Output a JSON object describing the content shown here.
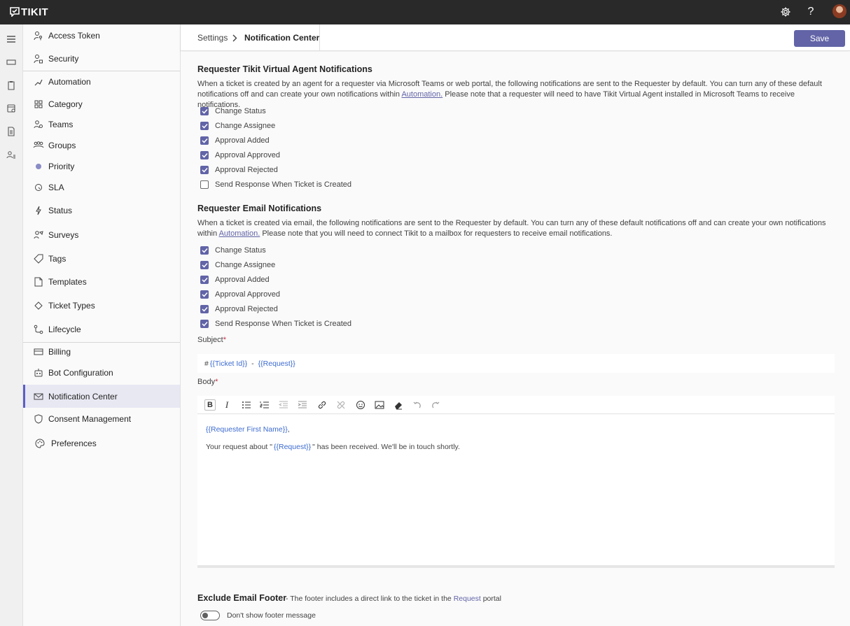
{
  "app": {
    "name": "TIKIT"
  },
  "colors": {
    "accent": "#6264a7",
    "topbar": "#292929",
    "token": "#3c6bd0",
    "required": "#c4314b"
  },
  "topbar_icons": [
    "gear-icon",
    "help-icon",
    "avatar"
  ],
  "topbar_text": {
    "help": "?"
  },
  "rail_icons": [
    "hamburger-icon",
    "tickets-icon",
    "clipboard-icon",
    "calendar-icon",
    "document-icon",
    "people-icon"
  ],
  "sidebar": {
    "items": [
      {
        "label": "Access Token",
        "icon": "key-person-icon"
      },
      {
        "label": "Security",
        "icon": "person-lock-icon"
      },
      {
        "label": "Automation",
        "icon": "flow-icon"
      },
      {
        "label": "Category",
        "icon": "grid-icon"
      },
      {
        "label": "Teams",
        "icon": "team-icon"
      },
      {
        "label": "Groups",
        "icon": "group-icon"
      },
      {
        "label": "Priority",
        "icon": "dot-icon"
      },
      {
        "label": "SLA",
        "icon": "timer-icon"
      },
      {
        "label": "Status",
        "icon": "lightning-icon"
      },
      {
        "label": "Surveys",
        "icon": "survey-icon"
      },
      {
        "label": "Tags",
        "icon": "tag-icon"
      },
      {
        "label": "Templates",
        "icon": "template-icon"
      },
      {
        "label": "Ticket Types",
        "icon": "diamond-icon"
      },
      {
        "label": "Lifecycle",
        "icon": "lifecycle-icon"
      },
      {
        "label": "Billing",
        "icon": "card-icon"
      },
      {
        "label": "Bot Configuration",
        "icon": "bot-icon"
      },
      {
        "label": "Notification Center",
        "icon": "mail-icon",
        "active": true
      },
      {
        "label": "Consent Management",
        "icon": "shield-icon"
      },
      {
        "label": "Preferences",
        "icon": "palette-icon"
      }
    ]
  },
  "breadcrumb": {
    "root": "Settings",
    "current": "Notification Center",
    "separator": "›"
  },
  "header": {
    "save_label": "Save"
  },
  "virtual_agent": {
    "title": "Requester Tikit Virtual Agent Notifications",
    "desc_before": "When a ticket is created by an agent for a requester via Microsoft Teams or web portal, the following notifications are sent to the Requester by default. You can turn any of these default notifications off and can create your own notifications within ",
    "desc_link": "Automation.",
    "desc_after": " Please note that a requester will need to have Tikit Virtual Agent installed in Microsoft Teams to receive notifications.",
    "options": [
      {
        "label": "Change Status",
        "checked": true
      },
      {
        "label": "Change Assignee",
        "checked": true
      },
      {
        "label": "Approval Added",
        "checked": true
      },
      {
        "label": "Approval Approved",
        "checked": true
      },
      {
        "label": "Approval Rejected",
        "checked": true
      },
      {
        "label": "Send Response When Ticket is Created",
        "checked": false
      }
    ]
  },
  "email": {
    "title": "Requester Email Notifications",
    "desc_before": "When a ticket is created via email, the following notifications are sent to the Requester by default. You can turn any of these default notifications off and can create your own notifications within ",
    "desc_link": "Automation.",
    "desc_after": " Please note that you will need to connect Tikit to a mailbox for requesters to receive email notifications.",
    "options": [
      {
        "label": "Change Status",
        "checked": true
      },
      {
        "label": "Change Assignee",
        "checked": true
      },
      {
        "label": "Approval Added",
        "checked": true
      },
      {
        "label": "Approval Approved",
        "checked": true
      },
      {
        "label": "Approval Rejected",
        "checked": true
      },
      {
        "label": "Send Response When Ticket is Created",
        "checked": true
      }
    ],
    "subject_label": "Subject",
    "required_mark": "*",
    "subject": {
      "prefix": "#",
      "token1": "{{Ticket Id}}",
      "sep": "-",
      "token2": "{{Request}}"
    },
    "body_label": "Body",
    "toolbar": [
      "bold-icon",
      "italic-icon",
      "bullet-list-icon",
      "numbered-list-icon",
      "outdent-icon",
      "indent-icon",
      "link-icon",
      "unlink-icon",
      "emoji-icon",
      "image-icon",
      "eraser-icon",
      "undo-icon",
      "redo-icon"
    ],
    "toolbar_text": {
      "bold": "B",
      "italic": "I"
    },
    "body": {
      "greeting_token": "{{Requester First Name}}",
      "greeting_punct": ",",
      "line_before": "Your request about \"",
      "line_token": "{{Request}}",
      "line_after": "\" has been received. We'll be in touch shortly."
    }
  },
  "footer": {
    "title": "Exclude Email Footer",
    "note_before": "- The footer includes a direct link to the ticket in the ",
    "note_highlight": "Request",
    "note_after": " portal",
    "toggle_label": "Don't show footer message",
    "toggle_on": false
  }
}
